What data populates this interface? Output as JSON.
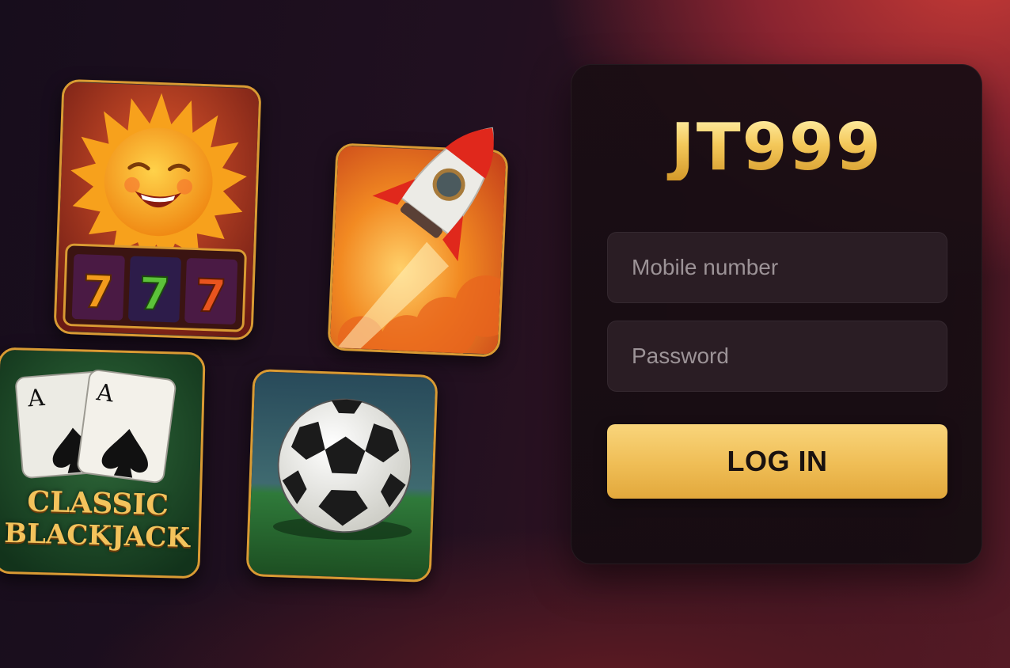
{
  "brand": {
    "title": "JT999",
    "color": "#f4c85a"
  },
  "login": {
    "mobile_placeholder": "Mobile number",
    "password_placeholder": "Password",
    "login_label": "LOG IN",
    "button_color": "#efbd55"
  },
  "games": [
    {
      "id": "slots",
      "icon": "sun-slot-777-icon",
      "reels": [
        "7",
        "7",
        "7"
      ]
    },
    {
      "id": "rocket",
      "icon": "rocket-crash-icon"
    },
    {
      "id": "blackjack",
      "icon": "ace-of-spades-cards-icon",
      "card_rank": "A",
      "title_line1": "CLASSIC",
      "title_line2": "BLACKJACK"
    },
    {
      "id": "soccer",
      "icon": "soccer-ball-icon"
    }
  ]
}
